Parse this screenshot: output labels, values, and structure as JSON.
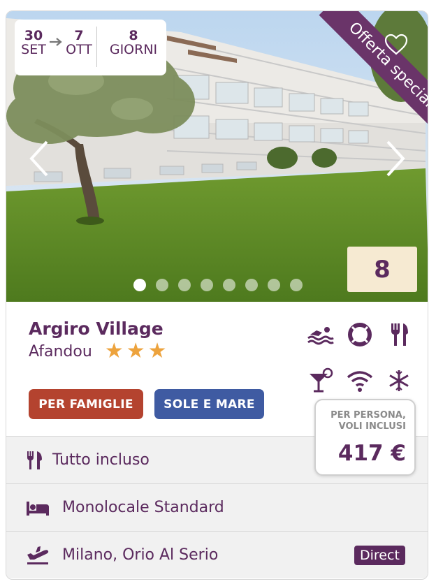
{
  "dates": {
    "from_day": "30",
    "from_month": "SET",
    "to_day": "7",
    "to_month": "OTT",
    "days_count": "8",
    "days_label": "GIORNI"
  },
  "ribbon": "Offerta speciale",
  "score": "8",
  "gallery": {
    "total_images": 8,
    "active_index": 0
  },
  "hotel": {
    "name": "Argiro Village",
    "location": "Afandou",
    "stars": 3
  },
  "amenity_icons": [
    "swimmer-icon",
    "lifebuoy-icon",
    "fork-knife-icon",
    "cocktail-icon",
    "wifi-icon",
    "snowflake-icon"
  ],
  "tags": [
    {
      "label": "PER FAMIGLIE",
      "color": "#b4432f"
    },
    {
      "label": "SOLE E MARE",
      "color": "#3f5ba2"
    }
  ],
  "price": {
    "note_line1": "PER PERSONA,",
    "note_line2": "VOLI INCLUSI",
    "amount": "417 €"
  },
  "rows": {
    "board": "Tutto incluso",
    "room": "Monolocale Standard",
    "flight": "Milano, Orio Al Serio",
    "flight_badge": "Direct"
  },
  "colors": {
    "brand": "#5b2a5e",
    "accent_star": "#eda33d",
    "score_bg": "#f6ead2"
  }
}
